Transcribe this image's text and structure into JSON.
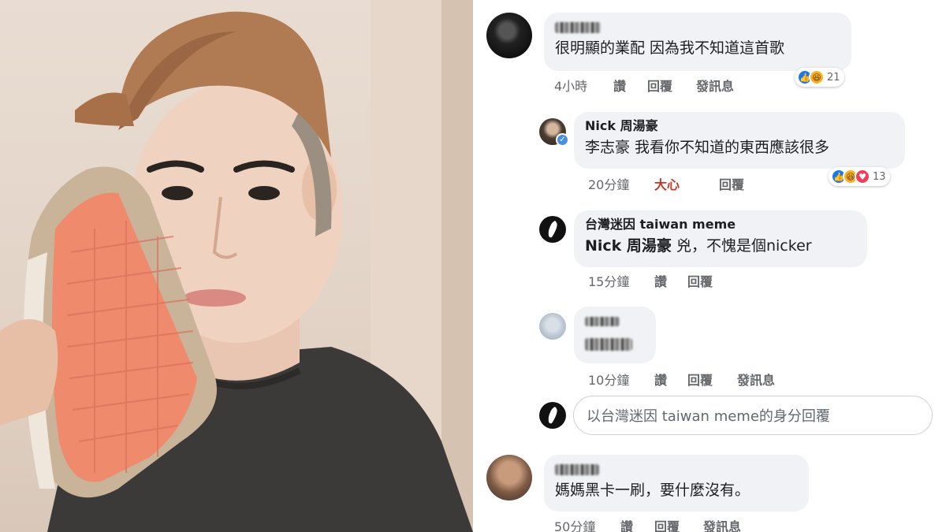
{
  "comments": [
    {
      "text": "很明顯的業配 因為我不知道這首歌",
      "time": "4小時",
      "actions": [
        "讚",
        "回覆",
        "發訊息"
      ],
      "reaction_count": "21",
      "reactions": [
        "like-icon",
        "haha-icon"
      ]
    },
    {
      "author": "Nick 周湯豪",
      "text": "李志豪 我看你不知道的東西應該很多",
      "time": "20分鐘",
      "actions": [
        "大心",
        "回覆"
      ],
      "reaction_count": "13",
      "reactions": [
        "like-icon",
        "haha-icon",
        "love-icon"
      ]
    },
    {
      "author": "台灣迷因 taiwan meme",
      "mention": "Nick 周湯豪",
      "text": " 兇，不愧是個nicker",
      "time": "15分鐘",
      "actions": [
        "讚",
        "回覆"
      ]
    },
    {
      "time": "10分鐘",
      "actions": [
        "讚",
        "回覆",
        "發訊息"
      ]
    },
    {
      "text": "媽媽黑卡一刷，要什麼沒有。",
      "time": "50分鐘",
      "actions": [
        "讚",
        "回覆",
        "發訊息"
      ]
    }
  ],
  "reply_input": {
    "placeholder": "以台灣迷因 taiwan meme的身分回覆"
  },
  "colors": {
    "bubble": "#f0f2f5",
    "meta_text": "#65676b",
    "love_action": "#c0392b",
    "like": "#1877f2"
  }
}
